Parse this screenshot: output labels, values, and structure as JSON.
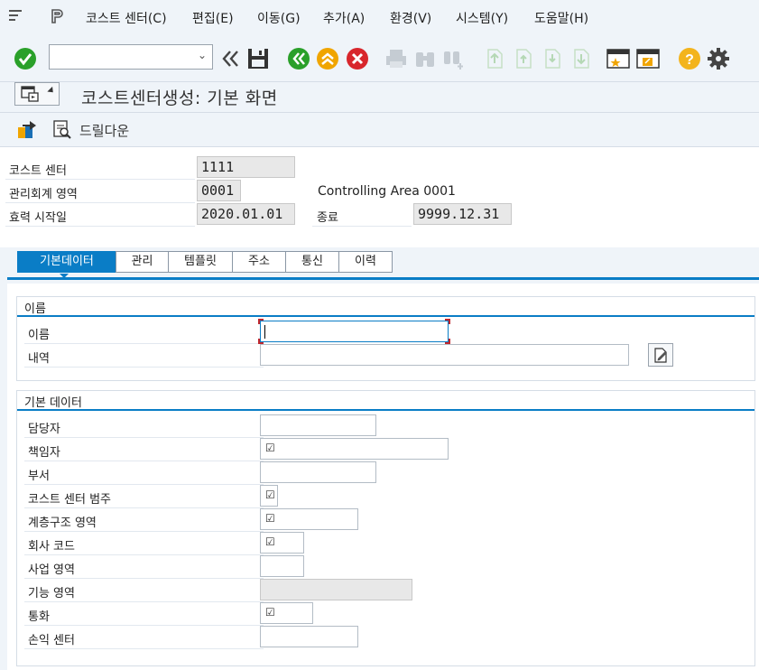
{
  "menu": {
    "items": [
      "코스트 센터(C)",
      "편집(E)",
      "이동(G)",
      "추가(A)",
      "환경(V)",
      "시스템(Y)",
      "도움말(H)"
    ]
  },
  "toolbar": {
    "command_field": "",
    "icons": [
      "enter-icon",
      "back-icon",
      "save-icon",
      "back-nav-icon",
      "exit-icon",
      "cancel-icon",
      "print-icon",
      "find-icon",
      "find-next-icon",
      "first-page-icon",
      "previous-page-icon",
      "next-page-icon",
      "last-page-icon",
      "new-session-icon",
      "shortcut-icon",
      "help-icon",
      "settings-icon"
    ],
    "colors": {
      "green": "#2aa02a",
      "orange": "#f0a500",
      "red": "#d8262c",
      "yellow": "#f3b41d"
    }
  },
  "title": "코스트센터생성: 기본 화면",
  "app_toolbar": {
    "drilldown_label": "드릴다운"
  },
  "header": {
    "cost_center_label": "코스트 센터",
    "cost_center_value": "1111",
    "controlling_area_label": "관리회계 영역",
    "controlling_area_value": "0001",
    "controlling_area_text": "Controlling Area 0001",
    "valid_from_label": "효력 시작일",
    "valid_from_value": "2020.01.01",
    "valid_to_label": "종료",
    "valid_to_value": "9999.12.31"
  },
  "tabs": [
    "기본데이터",
    "관리",
    "템플릿",
    "주소",
    "통신",
    "이력"
  ],
  "active_tab": "기본데이터",
  "name_group": {
    "title": "이름",
    "name_label": "이름",
    "name_value": "",
    "description_label": "내역",
    "description_value": ""
  },
  "basic_group": {
    "title": "기본 데이터",
    "person_responsible_label": "담당자",
    "user_responsible_label": "책임자",
    "department_label": "부서",
    "category_label": "코스트 센터 범주",
    "hierarchy_label": "계층구조 영역",
    "company_code_label": "회사 코드",
    "business_area_label": "사업 영역",
    "functional_area_label": "기능 영역",
    "currency_label": "통화",
    "profit_center_label": "손익 센터",
    "check_mark": "☑"
  },
  "accent_color": "#0a7dc6"
}
